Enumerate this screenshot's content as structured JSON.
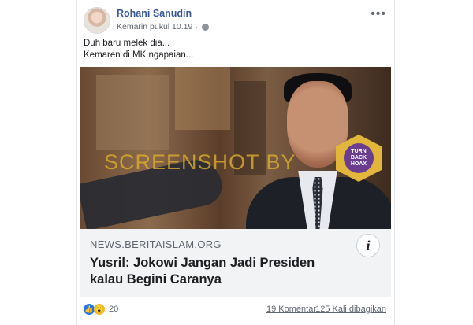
{
  "post": {
    "author": "Rohani Sanudin",
    "timestamp": "Kemarin pukul 10.19 ·",
    "privacy_icon": "globe-icon",
    "more_icon": "ellipsis-icon",
    "text_lines": [
      "Duh baru melek dia...",
      "Kemaren di MK ngapaian..."
    ]
  },
  "image": {
    "watermark": "SCREENSHOT BY",
    "badge_text": "TURN BACK HOAX"
  },
  "link_preview": {
    "domain": "NEWS.BERITAISLAM.ORG",
    "headline": "Yusril: Jokowi Jangan Jadi Presiden kalau Begini Caranya",
    "info_icon": "i"
  },
  "footer": {
    "reaction_count": "20",
    "comments": "19 Komentar",
    "shares": "125 Kali dibagikan"
  },
  "colors": {
    "author": "#385898",
    "like": "#2078f4",
    "wow": "#f7b928",
    "watermark": "#e0b12b"
  }
}
